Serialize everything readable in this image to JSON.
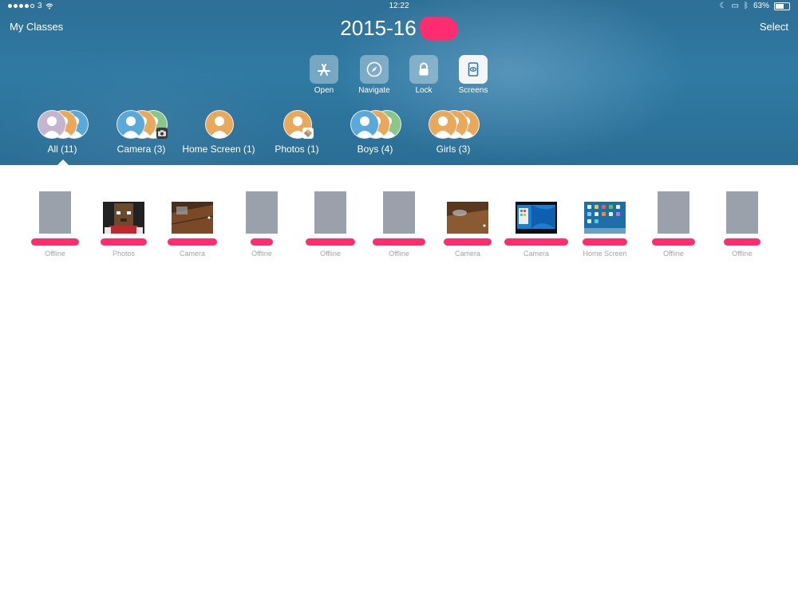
{
  "status_bar": {
    "carrier": "3",
    "time": "12:22",
    "battery": "63%",
    "battery_level": 0.63
  },
  "nav": {
    "back_label": "My Classes",
    "title": "2015-16",
    "select_label": "Select"
  },
  "tools": [
    {
      "label": "Open",
      "icon": "app-store-icon"
    },
    {
      "label": "Navigate",
      "icon": "compass-icon"
    },
    {
      "label": "Lock",
      "icon": "lock-icon"
    },
    {
      "label": "Screens",
      "icon": "screens-icon"
    }
  ],
  "groups": [
    {
      "label": "All (11)",
      "selected": true
    },
    {
      "label": "Camera (3)"
    },
    {
      "label": "Home Screen (1)"
    },
    {
      "label": "Photos (1)"
    },
    {
      "label": "Boys (4)"
    },
    {
      "label": "Girls (3)"
    }
  ],
  "students": [
    {
      "status": "Offline"
    },
    {
      "status": "Photos"
    },
    {
      "status": "Camera"
    },
    {
      "status": "Offline"
    },
    {
      "status": "Offline"
    },
    {
      "status": "Offline"
    },
    {
      "status": "Camera"
    },
    {
      "status": "Camera"
    },
    {
      "status": "Home Screen"
    },
    {
      "status": "Offline"
    },
    {
      "status": "Offline"
    }
  ],
  "colors": {
    "accent_redaction": "#ff2d6f",
    "header_blue": "#2f7aa3",
    "offline_gray": "#9aa1ab",
    "avatar_purple": "#c4b6cf",
    "avatar_orange": "#e8a95c",
    "avatar_blue": "#5aa9d8",
    "avatar_green": "#8cc58a"
  }
}
